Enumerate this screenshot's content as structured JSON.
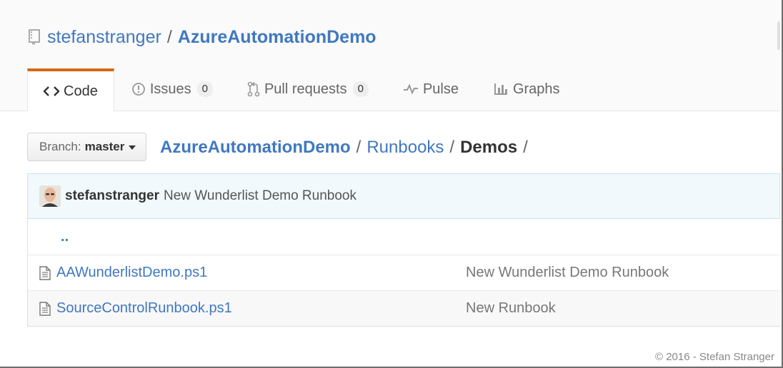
{
  "repo": {
    "owner": "stefanstranger",
    "separator": "/",
    "name": "AzureAutomationDemo"
  },
  "tabs": [
    {
      "label": "Code",
      "icon": "code-icon",
      "selected": true
    },
    {
      "label": "Issues",
      "icon": "issue-opened-icon",
      "count": "0"
    },
    {
      "label": "Pull requests",
      "icon": "git-pull-request-icon",
      "count": "0"
    },
    {
      "label": "Pulse",
      "icon": "pulse-icon"
    },
    {
      "label": "Graphs",
      "icon": "graph-icon"
    }
  ],
  "branch": {
    "prefix": "Branch:",
    "name": "master"
  },
  "breadcrumb": {
    "root": "AzureAutomationDemo",
    "sep1": "/",
    "folder": "Runbooks",
    "sep2": "/",
    "current": "Demos",
    "sep3": "/"
  },
  "commit": {
    "author": "stefanstranger",
    "message": "New Wunderlist Demo Runbook"
  },
  "files": {
    "up": "..",
    "items": [
      {
        "name": "AAWunderlistDemo.ps1",
        "message": "New Wunderlist Demo Runbook"
      },
      {
        "name": "SourceControlRunbook.ps1",
        "message": "New Runbook"
      }
    ]
  },
  "footer": {
    "copyright": "© 2016 - Stefan Stranger"
  },
  "colors": {
    "link": "#4078c0",
    "tab_accent": "#d26911",
    "commit_bg": "#f2f9fc"
  }
}
